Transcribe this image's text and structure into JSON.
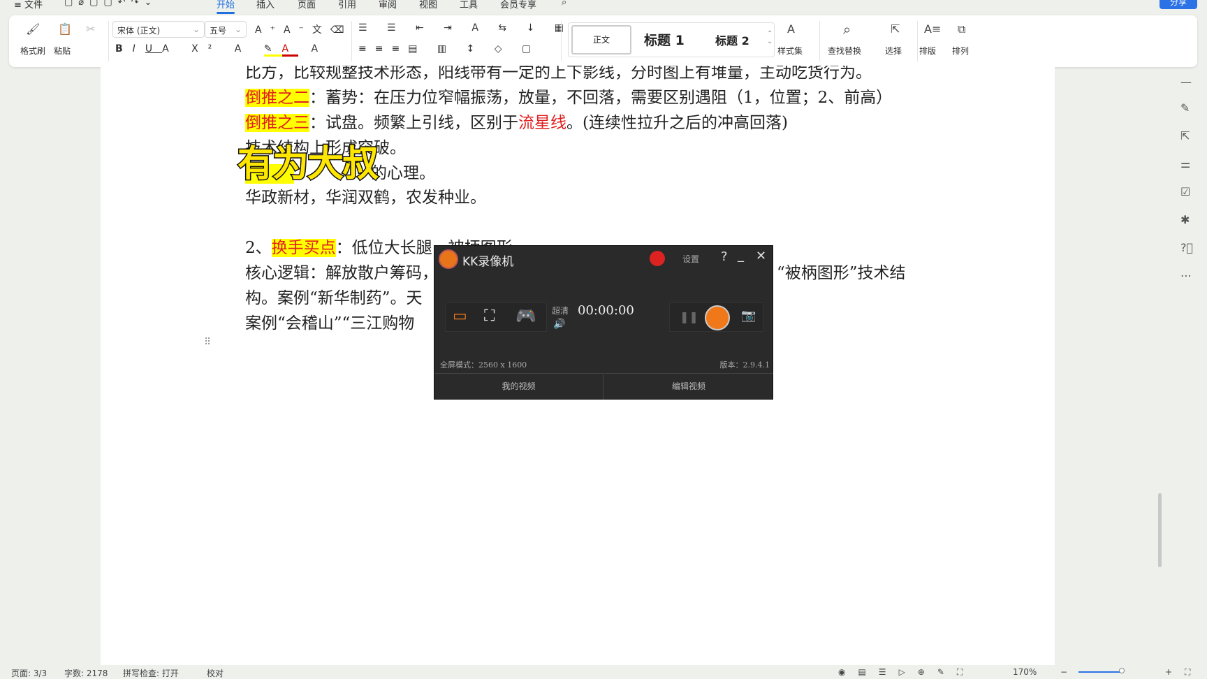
{
  "menu": {
    "file": "文件",
    "tabs": [
      "开始",
      "插入",
      "页面",
      "引用",
      "审阅",
      "视图",
      "工具",
      "会员专享"
    ],
    "share": "分享"
  },
  "ribbon": {
    "format_painter": "格式刷",
    "paste": "粘贴",
    "font": "宋体 (正文)",
    "size": "五号",
    "styles": [
      "正文",
      "标题 1",
      "标题 2"
    ],
    "style_set": "样式集",
    "find_replace": "查找替换",
    "select": "选择",
    "layout": "排版",
    "arrange": "排列"
  },
  "doc": {
    "line1": "比方，比较规整技术形态，阳线带有一定的上下影线，分时图上有堆量，主动吃货行为。",
    "line2_hl": "倒推之二",
    "line2": "：蓄势：在压力位窄幅振荡，放量，不回落，需要区别遇阻（1，位置；2、前高）",
    "line3_hl": "倒推之三",
    "line3a": "：试盘。频繁上引线，区别于",
    "line3_red": "流星线",
    "line3b": "。(连续性拉升之后的冲高回落)",
    "line4": "技术结构上形成突破。",
    "line5": "的心理。",
    "line6": "华政新材，华润双鹤，农发种业。",
    "line8_prefix": "2、",
    "line8_hl": "换手买点",
    "line8": "：低位大长腿，被柄图形",
    "line9": "核心逻辑：解放散户筹码，",
    "line9_right": "“被柄图形”技术结",
    "line10": "构。案例“新华制药”。天",
    "line11": "案例“会稽山”“三江购物"
  },
  "overlay": "有为大叔",
  "kk": {
    "title": "KK录像机",
    "settings": "设置",
    "help": "?",
    "quality": "超清",
    "timer": "00:00:00",
    "mode": "全屏模式：2560 x 1600",
    "version": "版本：2.9.4.1",
    "my_videos": "我的视频",
    "edit_video": "编辑视频",
    "accent": "#f07818"
  },
  "status": {
    "page": "页面: 3/3",
    "words": "字数: 2178",
    "spell": "拼写检查: 打开",
    "proof": "校对",
    "zoom": "170%"
  }
}
